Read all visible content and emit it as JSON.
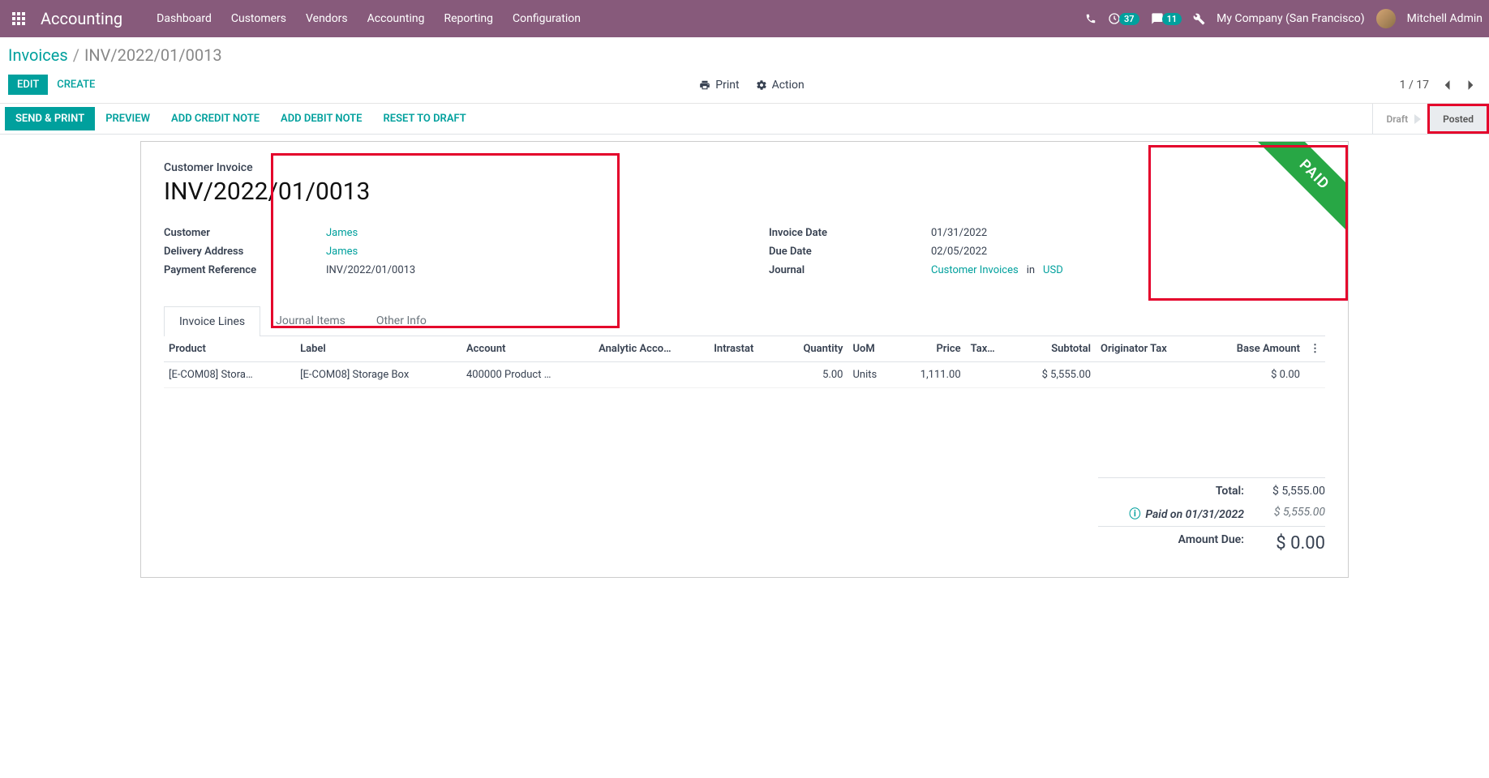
{
  "navbar": {
    "app_title": "Accounting",
    "menu": [
      "Dashboard",
      "Customers",
      "Vendors",
      "Accounting",
      "Reporting",
      "Configuration"
    ],
    "badge1": "37",
    "badge2": "11",
    "company": "My Company (San Francisco)",
    "user": "Mitchell Admin"
  },
  "breadcrumb": {
    "root": "Invoices",
    "current": "INV/2022/01/0013"
  },
  "controls": {
    "edit": "Edit",
    "create": "Create",
    "print": "Print",
    "action": "Action",
    "pager": "1 / 17"
  },
  "statusbar": {
    "send_print": "Send & Print",
    "preview": "Preview",
    "add_credit": "Add Credit Note",
    "add_debit": "Add Debit Note",
    "reset": "Reset to Draft",
    "draft": "Draft",
    "posted": "Posted"
  },
  "ribbon": "PAID",
  "invoice": {
    "type": "Customer Invoice",
    "number": "INV/2022/01/0013",
    "customer_label": "Customer",
    "customer": "James",
    "delivery_label": "Delivery Address",
    "delivery": "James",
    "payref_label": "Payment Reference",
    "payref": "INV/2022/01/0013",
    "invdate_label": "Invoice Date",
    "invdate": "01/31/2022",
    "duedate_label": "Due Date",
    "duedate": "02/05/2022",
    "journal_label": "Journal",
    "journal": "Customer Invoices",
    "journal_in": "in",
    "currency": "USD"
  },
  "tabs": {
    "lines": "Invoice Lines",
    "journal": "Journal Items",
    "other": "Other Info"
  },
  "table": {
    "headers": {
      "product": "Product",
      "label": "Label",
      "account": "Account",
      "analytic": "Analytic Acco…",
      "intrastat": "Intrastat",
      "quantity": "Quantity",
      "uom": "UoM",
      "price": "Price",
      "tax": "Tax…",
      "subtotal": "Subtotal",
      "originator": "Originator Tax",
      "base": "Base Amount"
    },
    "row": {
      "product": "[E-COM08] Stora…",
      "label": "[E-COM08] Storage Box",
      "account": "400000 Product …",
      "quantity": "5.00",
      "uom": "Units",
      "price": "1,111.00",
      "subtotal": "$ 5,555.00",
      "base": "$ 0.00"
    }
  },
  "totals": {
    "total_label": "Total:",
    "total": "$ 5,555.00",
    "paid_label": "Paid on 01/31/2022",
    "paid": "$ 5,555.00",
    "due_label": "Amount Due:",
    "due": "$ 0.00"
  }
}
